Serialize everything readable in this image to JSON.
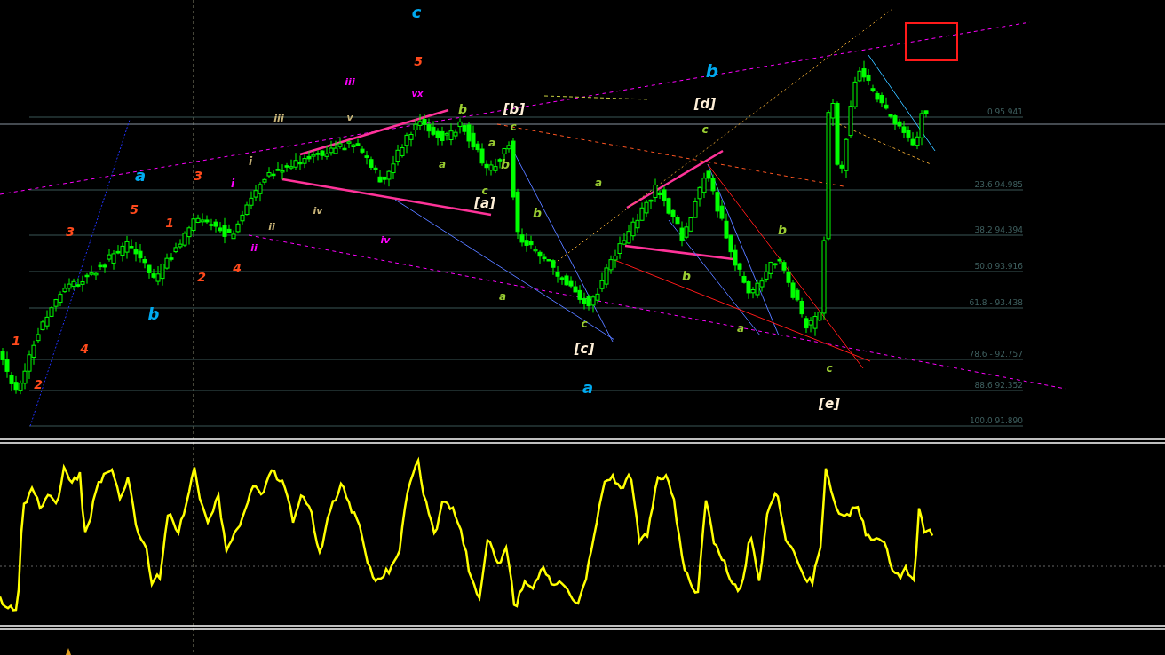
{
  "chart": {
    "fib_levels": [
      {
        "label": "0 95.941"
      },
      {
        "label": "23.6 94.985"
      },
      {
        "label": "38.2 94.394"
      },
      {
        "label": "50.0 93.916"
      },
      {
        "label": "61.8 - 93.438"
      },
      {
        "label": "78.6 - 92.757"
      },
      {
        "label": "88.6 92.352"
      },
      {
        "label": "100.0 91.890"
      }
    ],
    "wave_labels": [
      {
        "text": "c",
        "color": "#00aaf0"
      },
      {
        "text": "5",
        "color": "#ff4a1c"
      },
      {
        "text": "b",
        "color": "#00aaf0"
      },
      {
        "text": "iii",
        "color": "#ff00ff"
      },
      {
        "text": "vx",
        "color": "#ff00ff"
      },
      {
        "text": "b",
        "color": "#9acd32"
      },
      {
        "text": "[b]",
        "color": "#fff0d8"
      },
      {
        "text": "[d]",
        "color": "#fff0d8"
      },
      {
        "text": "iii",
        "color": "#c8b478"
      },
      {
        "text": "v",
        "color": "#c8b478"
      },
      {
        "text": "c",
        "color": "#9acd32"
      },
      {
        "text": "c",
        "color": "#9acd32"
      },
      {
        "text": "a",
        "color": "#9acd32"
      },
      {
        "text": "i",
        "color": "#c8b478"
      },
      {
        "text": "a",
        "color": "#9acd32"
      },
      {
        "text": "b",
        "color": "#9acd32"
      },
      {
        "text": "a",
        "color": "#00aaf0"
      },
      {
        "text": "3",
        "color": "#ff4a1c"
      },
      {
        "text": "i",
        "color": "#ff00ff"
      },
      {
        "text": "a",
        "color": "#9acd32"
      },
      {
        "text": "c",
        "color": "#9acd32"
      },
      {
        "text": "[a]",
        "color": "#fff0d8"
      },
      {
        "text": "5",
        "color": "#ff4a1c"
      },
      {
        "text": "iv",
        "color": "#c8b478"
      },
      {
        "text": "b",
        "color": "#9acd32"
      },
      {
        "text": "1",
        "color": "#ff4a1c"
      },
      {
        "text": "3",
        "color": "#ff4a1c"
      },
      {
        "text": "ii",
        "color": "#c8b478"
      },
      {
        "text": "b",
        "color": "#9acd32"
      },
      {
        "text": "iv",
        "color": "#ff00ff"
      },
      {
        "text": "ii",
        "color": "#ff00ff"
      },
      {
        "text": "4",
        "color": "#ff4a1c"
      },
      {
        "text": "2",
        "color": "#ff4a1c"
      },
      {
        "text": "b",
        "color": "#9acd32"
      },
      {
        "text": "a",
        "color": "#9acd32"
      },
      {
        "text": "b",
        "color": "#00aaf0"
      },
      {
        "text": "c",
        "color": "#9acd32"
      },
      {
        "text": "a",
        "color": "#9acd32"
      },
      {
        "text": "1",
        "color": "#ff4a1c"
      },
      {
        "text": "4",
        "color": "#ff4a1c"
      },
      {
        "text": "[c]",
        "color": "#fff0d8"
      },
      {
        "text": "c",
        "color": "#9acd32"
      },
      {
        "text": "2",
        "color": "#ff4a1c"
      },
      {
        "text": "a",
        "color": "#00aaf0"
      },
      {
        "text": "[e]",
        "color": "#fff0d8"
      }
    ]
  }
}
